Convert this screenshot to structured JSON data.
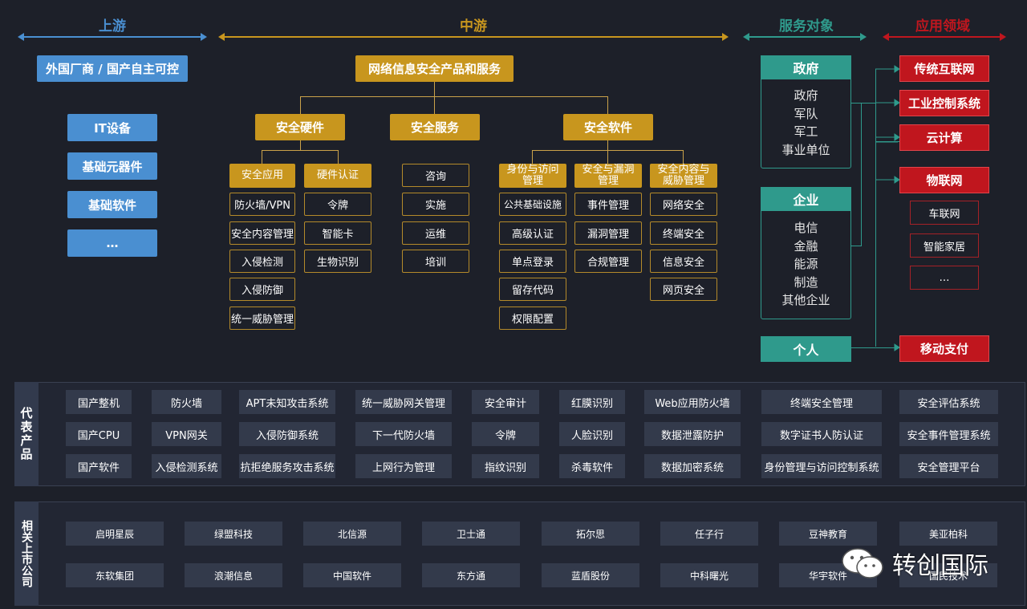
{
  "headers": {
    "upstream": "上游",
    "midstream": "中游",
    "service": "服务对象",
    "application": "应用领域"
  },
  "colors": {
    "upstream": "#4a8fd1",
    "midstream": "#c8961e",
    "service": "#2f9a8c",
    "application": "#c0161e"
  },
  "upstream": {
    "top": "外国厂商 / 国产自主可控",
    "items": [
      "IT设备",
      "基础元器件",
      "基础软件",
      "…"
    ]
  },
  "midstream": {
    "root": "网络信息安全产品和服务",
    "hardware": {
      "title": "安全硬件",
      "app": {
        "title": "安全应用",
        "items": [
          "防火墙/VPN",
          "安全内容管理",
          "入侵检测",
          "入侵防御",
          "统一威胁管理"
        ]
      },
      "auth": {
        "title": "硬件认证",
        "items": [
          "令牌",
          "智能卡",
          "生物识别"
        ]
      }
    },
    "service": {
      "title": "安全服务",
      "items": [
        "咨询",
        "实施",
        "运维",
        "培训"
      ]
    },
    "software": {
      "title": "安全软件",
      "iam": {
        "title": "身份与访问管理",
        "items": [
          "公共基础设施",
          "高级认证",
          "单点登录",
          "留存代码",
          "权限配置"
        ]
      },
      "vuln": {
        "title": "安全与漏洞管理",
        "items": [
          "事件管理",
          "漏洞管理",
          "合规管理"
        ]
      },
      "content": {
        "title": "安全内容与威胁管理",
        "items": [
          "网络安全",
          "终端安全",
          "信息安全",
          "网页安全"
        ]
      }
    }
  },
  "service": {
    "gov": {
      "title": "政府",
      "items": [
        "政府",
        "军队",
        "军工",
        "事业单位"
      ]
    },
    "ent": {
      "title": "企业",
      "items": [
        "电信",
        "金融",
        "能源",
        "制造",
        "其他企业"
      ]
    },
    "personal": {
      "title": "个人"
    }
  },
  "application": {
    "internet": "传统互联网",
    "industrial": "工业控制系统",
    "cloud": "云计算",
    "iot": "物联网",
    "iot_items": [
      "车联网",
      "智能家居",
      "…"
    ],
    "mobile": "移动支付"
  },
  "products": {
    "label": "代表产品",
    "rows": [
      [
        "国产整机",
        "防火墙",
        "APT未知攻击系统",
        "统一威胁网关管理",
        "安全审计",
        "红膜识别",
        "Web应用防火墙",
        "终端安全管理",
        "安全评估系统"
      ],
      [
        "国产CPU",
        "VPN网关",
        "入侵防御系统",
        "下一代防火墙",
        "令牌",
        "人脸识别",
        "数据泄露防护",
        "数字证书人防认证",
        "安全事件管理系统"
      ],
      [
        "国产软件",
        "入侵检测系统",
        "抗拒绝服务攻击系统",
        "上网行为管理",
        "指纹识别",
        "杀毒软件",
        "数据加密系统",
        "身份管理与访问控制系统",
        "安全管理平台"
      ]
    ]
  },
  "companies": {
    "label": "相关上市公司",
    "rows": [
      [
        "启明星辰",
        "绿盟科技",
        "北信源",
        "卫士通",
        "拓尔思",
        "任子行",
        "豆神教育",
        "美亚柏科"
      ],
      [
        "东软集团",
        "浪潮信息",
        "中国软件",
        "东方通",
        "蓝盾股份",
        "中科曙光",
        "华宇软件",
        "国民技术"
      ]
    ]
  },
  "watermark": "转创国际"
}
